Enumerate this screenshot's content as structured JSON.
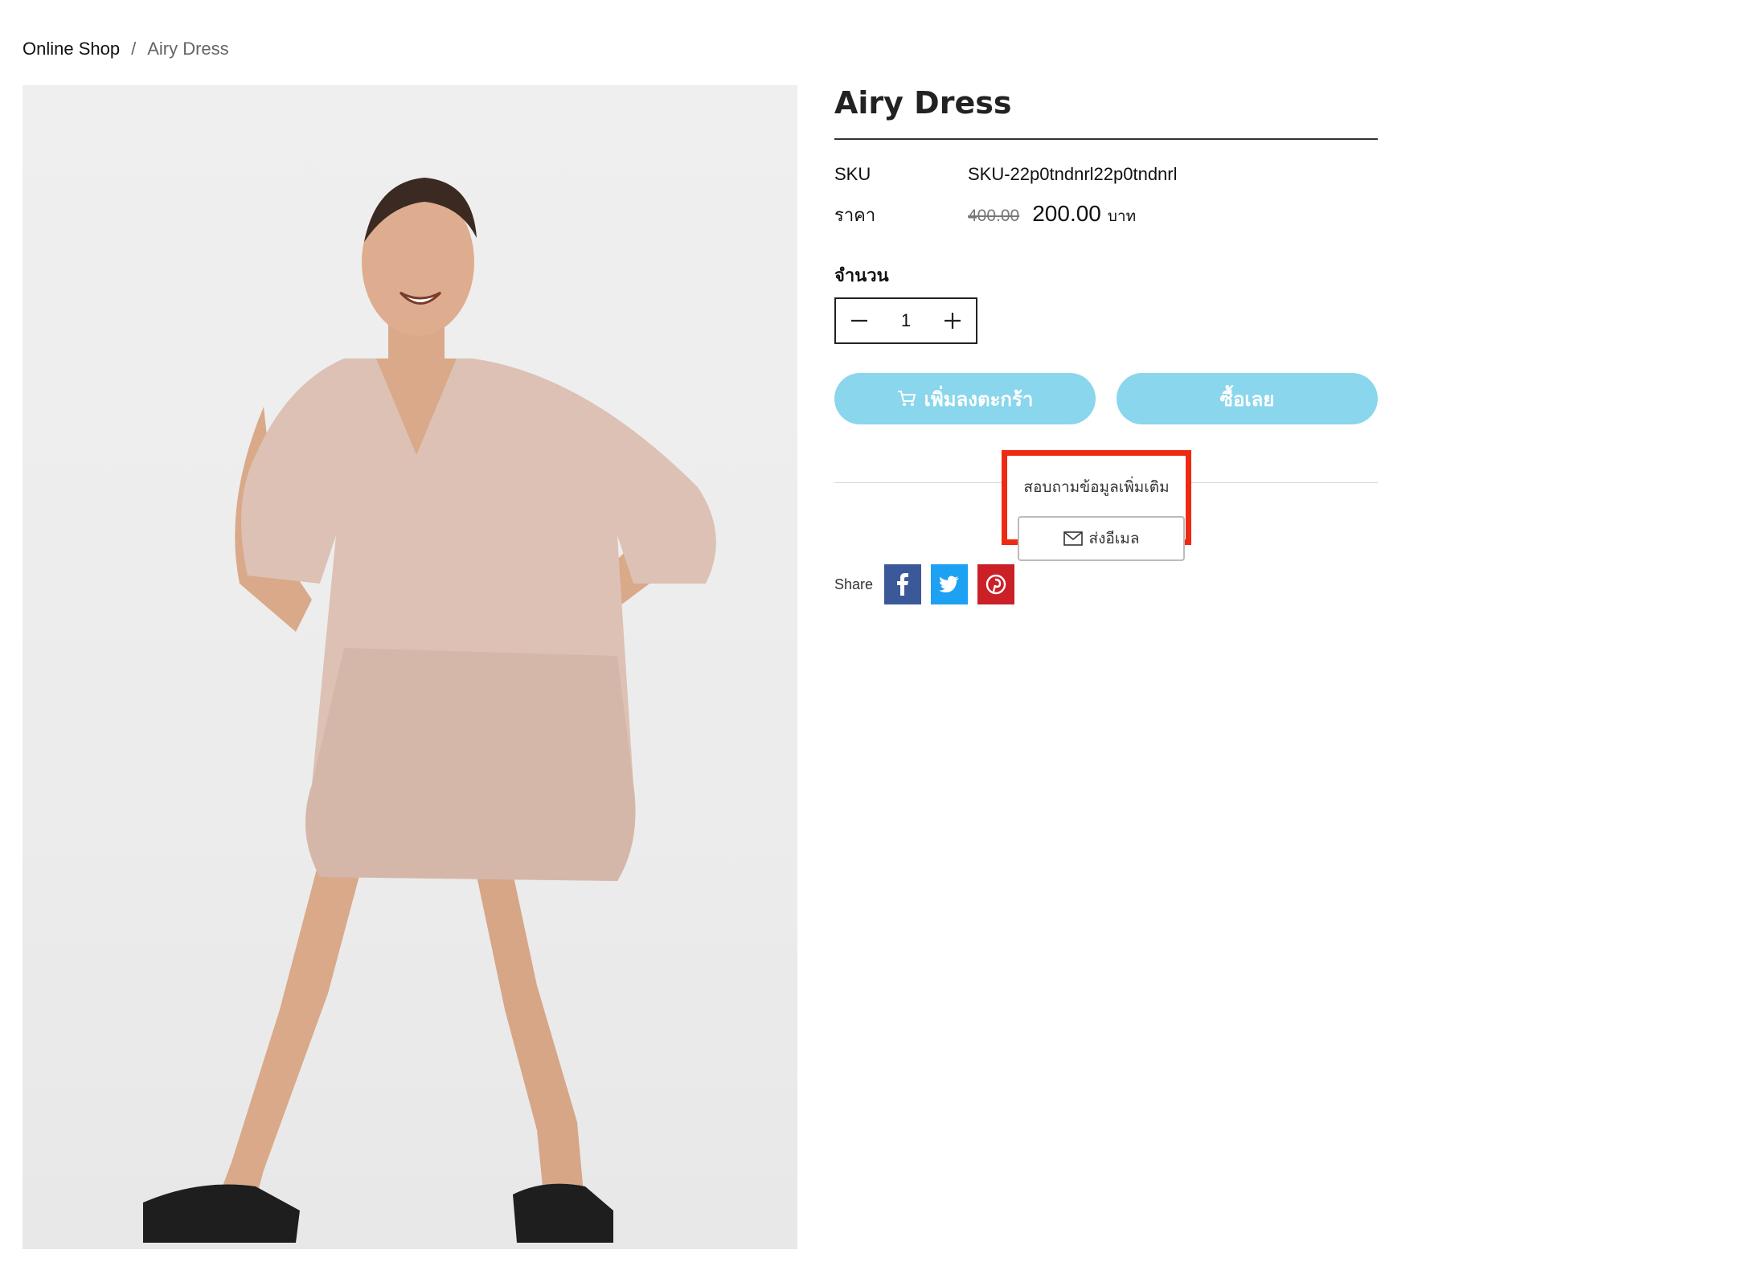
{
  "breadcrumb": {
    "home": "Online Shop",
    "separator": "/",
    "current": "Airy Dress"
  },
  "product": {
    "title": "Airy Dress",
    "sku_label": "SKU",
    "sku_value": "SKU-22p0tndnrl22p0tndnrl",
    "price_label": "ราคา",
    "old_price": "400.00",
    "new_price": "200.00",
    "currency": "บาท",
    "image_alt": "Airy Dress product photo"
  },
  "quantity": {
    "label": "จำนวน",
    "value": "1"
  },
  "actions": {
    "add_to_cart": "เพิ่มลงตะกร้า",
    "buy_now": "ซื้อเลย"
  },
  "inquiry": {
    "title": "สอบถามข้อมูลเพิ่มเติม",
    "email_button": "ส่งอีเมล"
  },
  "share": {
    "label": "Share"
  },
  "colors": {
    "accent_button": "#8ad6ec",
    "highlight": "#ee2a12",
    "facebook": "#3b5998",
    "twitter": "#1da1f2",
    "pinterest": "#cb2027"
  }
}
